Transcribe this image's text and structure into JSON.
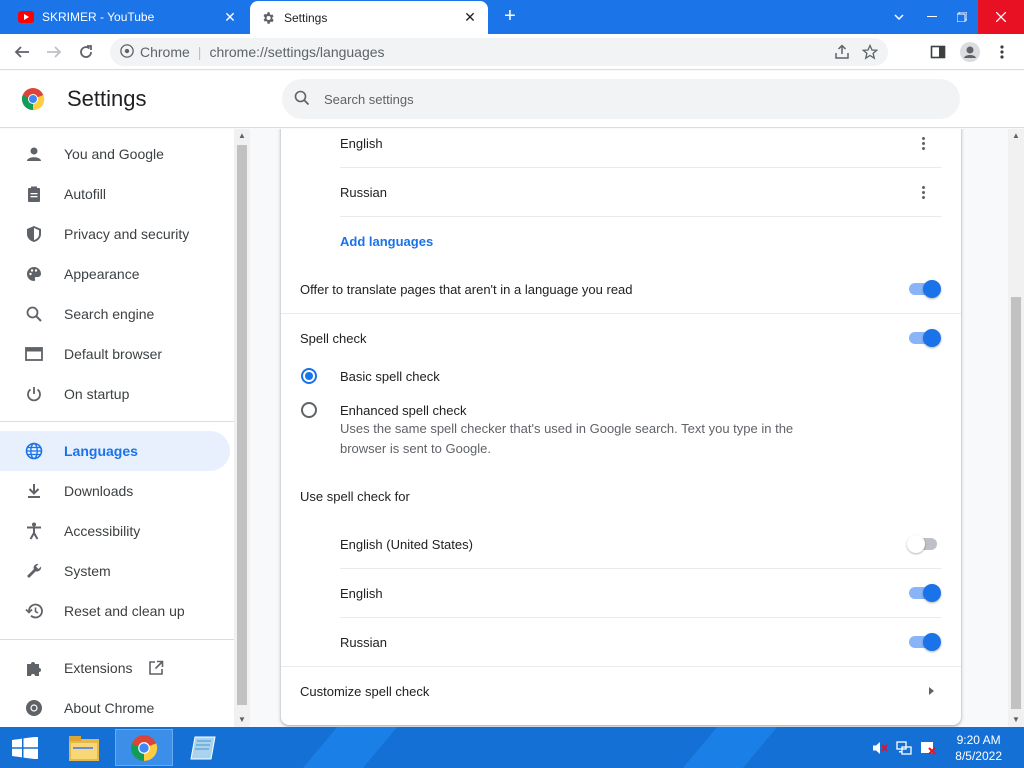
{
  "browser": {
    "tabs": [
      {
        "title": "SKRIMER - YouTube",
        "favicon": "youtube-icon",
        "active": false
      },
      {
        "title": "Settings",
        "favicon": "gear-icon",
        "active": true
      }
    ],
    "new_tab_label": "+",
    "site_label": "Chrome",
    "url": "chrome://settings/languages",
    "accent": "#1b74e8"
  },
  "settings": {
    "title": "Settings",
    "search_placeholder": "Search settings"
  },
  "sidebar": {
    "items": [
      {
        "label": "You and Google",
        "icon": "person-icon"
      },
      {
        "label": "Autofill",
        "icon": "clipboard-icon"
      },
      {
        "label": "Privacy and security",
        "icon": "shield-icon"
      },
      {
        "label": "Appearance",
        "icon": "palette-icon"
      },
      {
        "label": "Search engine",
        "icon": "search-icon"
      },
      {
        "label": "Default browser",
        "icon": "browser-icon"
      },
      {
        "label": "On startup",
        "icon": "power-icon"
      },
      {
        "label": "Languages",
        "icon": "globe-icon",
        "selected": true
      },
      {
        "label": "Downloads",
        "icon": "download-icon"
      },
      {
        "label": "Accessibility",
        "icon": "accessibility-icon"
      },
      {
        "label": "System",
        "icon": "wrench-icon"
      },
      {
        "label": "Reset and clean up",
        "icon": "history-icon"
      },
      {
        "label": "Extensions",
        "icon": "puzzle-icon"
      },
      {
        "label": "About Chrome",
        "icon": "chrome-icon"
      }
    ]
  },
  "languages": {
    "preferred": [
      {
        "name": "English"
      },
      {
        "name": "Russian"
      }
    ],
    "add_languages": "Add languages",
    "offer_translate": {
      "label": "Offer to translate pages that aren't in a language you read",
      "on": true
    },
    "spell_check": {
      "label": "Spell check",
      "on": true
    },
    "basic": {
      "label": "Basic spell check",
      "selected": true
    },
    "enhanced": {
      "label": "Enhanced spell check",
      "desc_line1": "Uses the same spell checker that's used in Google search. Text you type in the",
      "desc_line2": "browser is sent to Google.",
      "selected": false
    },
    "use_for_label": "Use spell check for",
    "spell_langs": [
      {
        "name": "English (United States)",
        "on": false
      },
      {
        "name": "English",
        "on": true
      },
      {
        "name": "Russian",
        "on": true
      }
    ],
    "customize": "Customize spell check"
  },
  "taskbar": {
    "time": "9:20 AM",
    "date": "8/5/2022"
  }
}
